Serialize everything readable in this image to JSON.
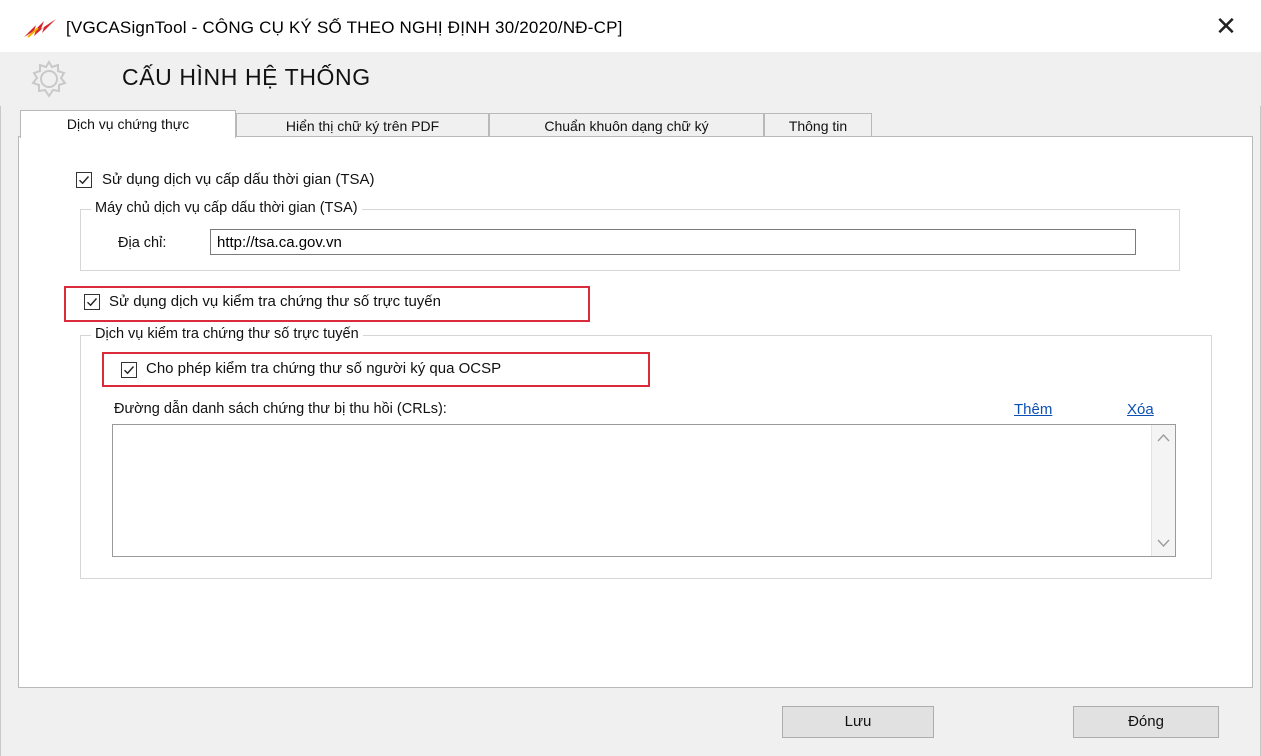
{
  "window": {
    "title": "[VGCASignTool - CÔNG CỤ KÝ SỐ THEO NGHỊ ĐỊNH 30/2020/NĐ-CP]",
    "close_label": "✕",
    "app_icon": "vgca-logo-icon"
  },
  "header": {
    "title": "CẤU HÌNH HỆ THỐNG",
    "icon": "gear-icon"
  },
  "tabs": [
    {
      "label": "Dịch vụ chứng thực",
      "active": true
    },
    {
      "label": "Hiển thị chữ ký trên PDF",
      "active": false
    },
    {
      "label": "Chuẩn khuôn dạng chữ ký",
      "active": false
    },
    {
      "label": "Thông tin",
      "active": false
    }
  ],
  "tsa": {
    "checkbox_label": "Sử dụng dịch vụ cấp dấu thời gian (TSA)",
    "checked": true,
    "group_title": "Máy chủ dịch vụ cấp dấu thời gian (TSA)",
    "address_label": "Địa chỉ:",
    "address_value": "http://tsa.ca.gov.vn"
  },
  "online_check": {
    "checkbox_label": "Sử dụng dịch vụ kiểm tra chứng thư số trực tuyến",
    "checked": true,
    "group_title": "Dịch vụ kiểm tra chứng thư số trực tuyến",
    "ocsp_label": "Cho phép kiểm tra chứng thư số người ký qua OCSP",
    "ocsp_checked": true,
    "crl_label": "Đường dẫn danh sách chứng thư bị thu hồi (CRLs):",
    "add_link": "Thêm",
    "delete_link": "Xóa",
    "crl_items": []
  },
  "highlight_color": "#d92b3a",
  "buttons": {
    "save": "Lưu",
    "close": "Đóng"
  }
}
